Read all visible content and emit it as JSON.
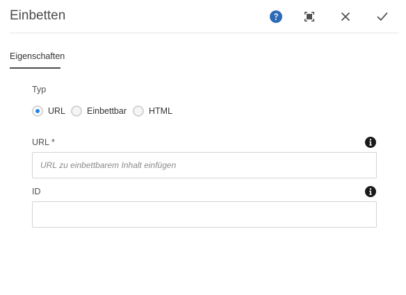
{
  "dialog": {
    "title": "Einbetten",
    "actions": [
      {
        "name": "help",
        "icon": "help-icon",
        "color": "#2d6ab6"
      },
      {
        "name": "fullscreen",
        "icon": "fullscreen-icon"
      },
      {
        "name": "cancel",
        "icon": "close-icon"
      },
      {
        "name": "done",
        "icon": "checkmark-icon"
      }
    ]
  },
  "tabs": [
    {
      "label": "Eigenschaften",
      "active": true
    }
  ],
  "type": {
    "label": "Typ",
    "options": [
      {
        "label": "URL",
        "checked": true
      },
      {
        "label": "Einbettbar",
        "checked": false
      },
      {
        "label": "HTML",
        "checked": false
      }
    ]
  },
  "fields": {
    "url": {
      "label": "URL *",
      "placeholder": "URL zu einbettbarem Inhalt einfügen",
      "value": "",
      "info_icon": "info-icon"
    },
    "id": {
      "label": "ID",
      "placeholder": "",
      "value": "",
      "info_icon": "info-icon"
    }
  },
  "colors": {
    "accent": "#2680eb",
    "help": "#2d6ab6"
  }
}
